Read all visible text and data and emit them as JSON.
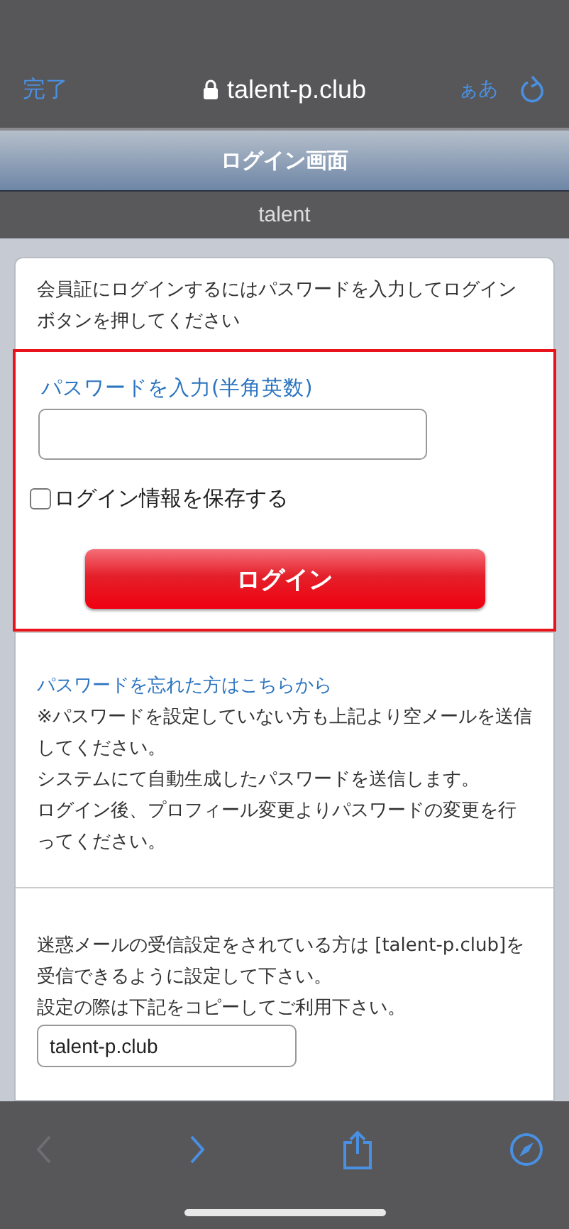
{
  "browser": {
    "done": "完了",
    "domain": "talent-p.club",
    "text_size": "ぁあ",
    "back_disabled": true,
    "forward_disabled": false
  },
  "header": {
    "title": "ログイン画面",
    "subtitle": "talent"
  },
  "intro": "会員証にログインするにはパスワードを入力してログインボタンを押してください",
  "login": {
    "highlighted": true,
    "password_label": "パスワードを入力(半角英数)",
    "remember": {
      "label": "ログイン情報を保存する",
      "checked": false
    },
    "button": "ログイン"
  },
  "forgot": {
    "link": "パスワードを忘れた方はこちらから",
    "lines": [
      "※パスワードを設定していない方も上記より空メールを送信してください。",
      "システムにて自動生成したパスワードを送信します。",
      "ログイン後、プロフィール変更よりパスワードの変更を行ってください。"
    ]
  },
  "spam": {
    "lines": [
      "迷惑メールの受信設定をされている方は [talent-p.club]を受信できるように設定して下さい。",
      "設定の際は下記をコピーしてご利用下さい。"
    ],
    "domain_value": "talent-p.club"
  }
}
